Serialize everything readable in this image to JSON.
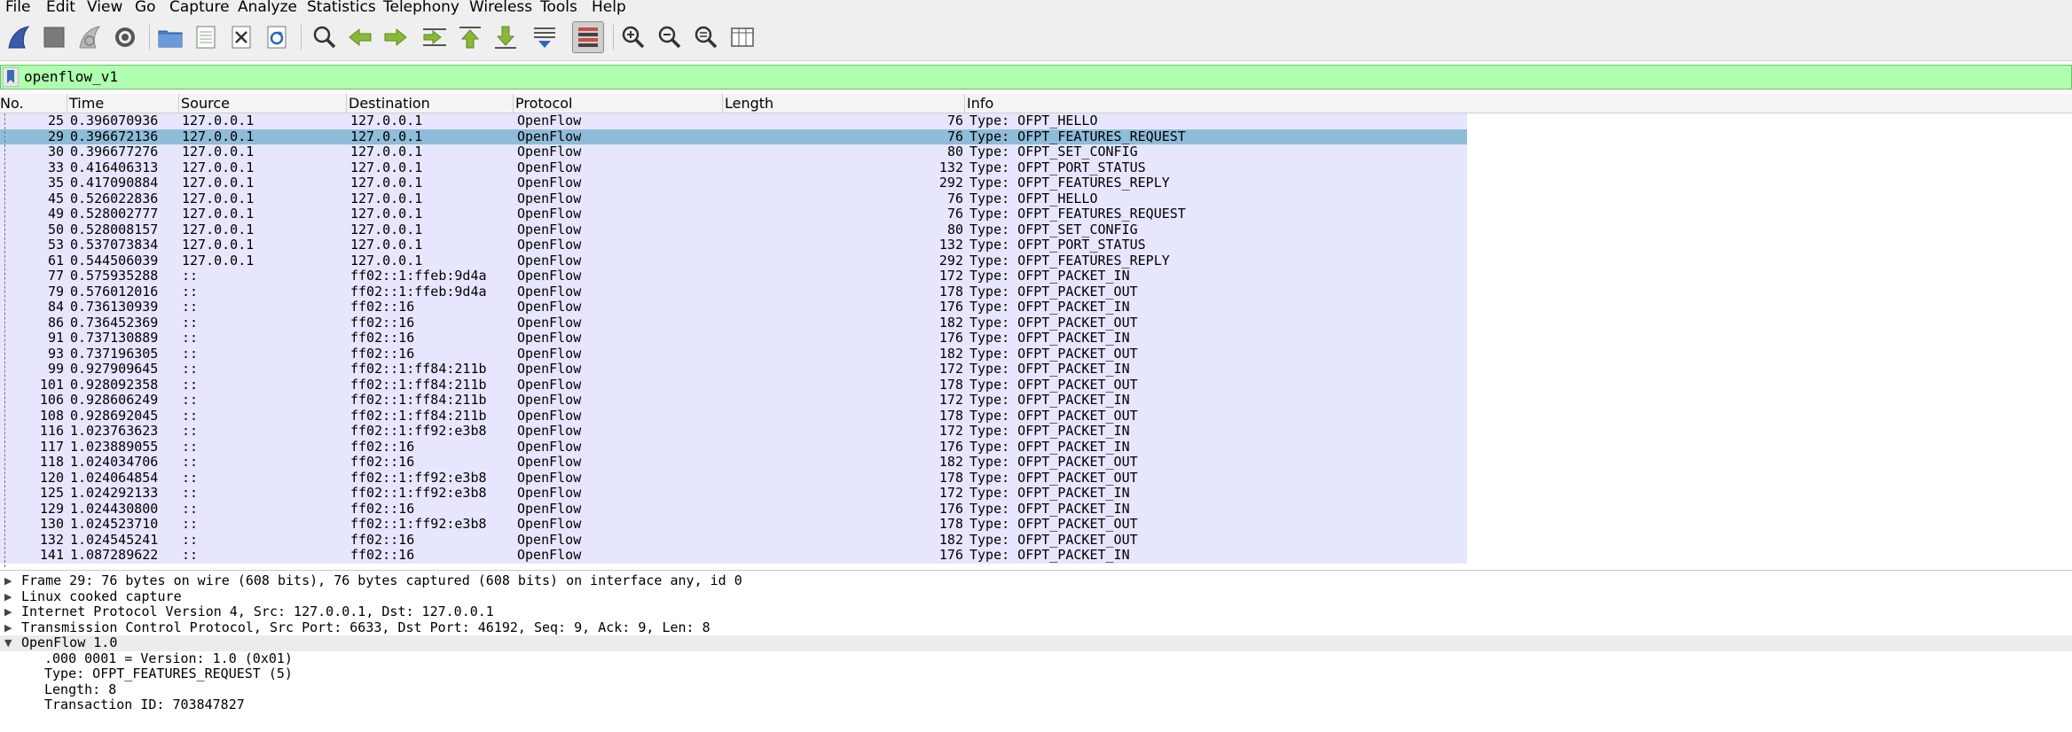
{
  "menu": [
    "File",
    "Edit",
    "View",
    "Go",
    "Capture",
    "Analyze",
    "Statistics",
    "Telephony",
    "Wireless",
    "Tools",
    "Help"
  ],
  "toolbar_icons": [
    "shark-fin-start-icon",
    "stop-square-icon",
    "shark-fin-restart-icon",
    "gear-options-icon",
    "folder-open-icon",
    "file-save-icon",
    "file-close-icon",
    "reload-icon",
    "find-magnifier-icon",
    "go-back-arrow-icon",
    "go-forward-arrow-icon",
    "go-to-packet-icon",
    "go-first-packet-icon",
    "go-last-packet-icon",
    "autoscroll-icon",
    "colorize-icon",
    "zoom-in-icon",
    "zoom-out-icon",
    "zoom-normal-icon",
    "resize-columns-icon"
  ],
  "filter": {
    "value": "openflow_v1"
  },
  "columns": [
    "No.",
    "Time",
    "Source",
    "Destination",
    "Protocol",
    "Length",
    "Info"
  ],
  "packets": [
    {
      "no": "25",
      "time": "0.396070936",
      "src": "127.0.0.1",
      "dst": "127.0.0.1",
      "proto": "OpenFlow",
      "len": "76",
      "info": "Type: OFPT_HELLO"
    },
    {
      "no": "29",
      "time": "0.396672136",
      "src": "127.0.0.1",
      "dst": "127.0.0.1",
      "proto": "OpenFlow",
      "len": "76",
      "info": "Type: OFPT_FEATURES_REQUEST",
      "selected": true
    },
    {
      "no": "30",
      "time": "0.396677276",
      "src": "127.0.0.1",
      "dst": "127.0.0.1",
      "proto": "OpenFlow",
      "len": "80",
      "info": "Type: OFPT_SET_CONFIG"
    },
    {
      "no": "33",
      "time": "0.416406313",
      "src": "127.0.0.1",
      "dst": "127.0.0.1",
      "proto": "OpenFlow",
      "len": "132",
      "info": "Type: OFPT_PORT_STATUS"
    },
    {
      "no": "35",
      "time": "0.417090884",
      "src": "127.0.0.1",
      "dst": "127.0.0.1",
      "proto": "OpenFlow",
      "len": "292",
      "info": "Type: OFPT_FEATURES_REPLY"
    },
    {
      "no": "45",
      "time": "0.526022836",
      "src": "127.0.0.1",
      "dst": "127.0.0.1",
      "proto": "OpenFlow",
      "len": "76",
      "info": "Type: OFPT_HELLO"
    },
    {
      "no": "49",
      "time": "0.528002777",
      "src": "127.0.0.1",
      "dst": "127.0.0.1",
      "proto": "OpenFlow",
      "len": "76",
      "info": "Type: OFPT_FEATURES_REQUEST"
    },
    {
      "no": "50",
      "time": "0.528008157",
      "src": "127.0.0.1",
      "dst": "127.0.0.1",
      "proto": "OpenFlow",
      "len": "80",
      "info": "Type: OFPT_SET_CONFIG"
    },
    {
      "no": "53",
      "time": "0.537073834",
      "src": "127.0.0.1",
      "dst": "127.0.0.1",
      "proto": "OpenFlow",
      "len": "132",
      "info": "Type: OFPT_PORT_STATUS"
    },
    {
      "no": "61",
      "time": "0.544506039",
      "src": "127.0.0.1",
      "dst": "127.0.0.1",
      "proto": "OpenFlow",
      "len": "292",
      "info": "Type: OFPT_FEATURES_REPLY"
    },
    {
      "no": "77",
      "time": "0.575935288",
      "src": "::",
      "dst": "ff02::1:ffeb:9d4a",
      "proto": "OpenFlow",
      "len": "172",
      "info": "Type: OFPT_PACKET_IN"
    },
    {
      "no": "79",
      "time": "0.576012016",
      "src": "::",
      "dst": "ff02::1:ffeb:9d4a",
      "proto": "OpenFlow",
      "len": "178",
      "info": "Type: OFPT_PACKET_OUT"
    },
    {
      "no": "84",
      "time": "0.736130939",
      "src": "::",
      "dst": "ff02::16",
      "proto": "OpenFlow",
      "len": "176",
      "info": "Type: OFPT_PACKET_IN"
    },
    {
      "no": "86",
      "time": "0.736452369",
      "src": "::",
      "dst": "ff02::16",
      "proto": "OpenFlow",
      "len": "182",
      "info": "Type: OFPT_PACKET_OUT"
    },
    {
      "no": "91",
      "time": "0.737130889",
      "src": "::",
      "dst": "ff02::16",
      "proto": "OpenFlow",
      "len": "176",
      "info": "Type: OFPT_PACKET_IN"
    },
    {
      "no": "93",
      "time": "0.737196305",
      "src": "::",
      "dst": "ff02::16",
      "proto": "OpenFlow",
      "len": "182",
      "info": "Type: OFPT_PACKET_OUT"
    },
    {
      "no": "99",
      "time": "0.927909645",
      "src": "::",
      "dst": "ff02::1:ff84:211b",
      "proto": "OpenFlow",
      "len": "172",
      "info": "Type: OFPT_PACKET_IN"
    },
    {
      "no": "101",
      "time": "0.928092358",
      "src": "::",
      "dst": "ff02::1:ff84:211b",
      "proto": "OpenFlow",
      "len": "178",
      "info": "Type: OFPT_PACKET_OUT"
    },
    {
      "no": "106",
      "time": "0.928606249",
      "src": "::",
      "dst": "ff02::1:ff84:211b",
      "proto": "OpenFlow",
      "len": "172",
      "info": "Type: OFPT_PACKET_IN"
    },
    {
      "no": "108",
      "time": "0.928692045",
      "src": "::",
      "dst": "ff02::1:ff84:211b",
      "proto": "OpenFlow",
      "len": "178",
      "info": "Type: OFPT_PACKET_OUT"
    },
    {
      "no": "116",
      "time": "1.023763623",
      "src": "::",
      "dst": "ff02::1:ff92:e3b8",
      "proto": "OpenFlow",
      "len": "172",
      "info": "Type: OFPT_PACKET_IN"
    },
    {
      "no": "117",
      "time": "1.023889055",
      "src": "::",
      "dst": "ff02::16",
      "proto": "OpenFlow",
      "len": "176",
      "info": "Type: OFPT_PACKET_IN"
    },
    {
      "no": "118",
      "time": "1.024034706",
      "src": "::",
      "dst": "ff02::16",
      "proto": "OpenFlow",
      "len": "182",
      "info": "Type: OFPT_PACKET_OUT"
    },
    {
      "no": "120",
      "time": "1.024064854",
      "src": "::",
      "dst": "ff02::1:ff92:e3b8",
      "proto": "OpenFlow",
      "len": "178",
      "info": "Type: OFPT_PACKET_OUT"
    },
    {
      "no": "125",
      "time": "1.024292133",
      "src": "::",
      "dst": "ff02::1:ff92:e3b8",
      "proto": "OpenFlow",
      "len": "172",
      "info": "Type: OFPT_PACKET_IN"
    },
    {
      "no": "129",
      "time": "1.024430800",
      "src": "::",
      "dst": "ff02::16",
      "proto": "OpenFlow",
      "len": "176",
      "info": "Type: OFPT_PACKET_IN"
    },
    {
      "no": "130",
      "time": "1.024523710",
      "src": "::",
      "dst": "ff02::1:ff92:e3b8",
      "proto": "OpenFlow",
      "len": "178",
      "info": "Type: OFPT_PACKET_OUT"
    },
    {
      "no": "132",
      "time": "1.024545241",
      "src": "::",
      "dst": "ff02::16",
      "proto": "OpenFlow",
      "len": "182",
      "info": "Type: OFPT_PACKET_OUT"
    },
    {
      "no": "141",
      "time": "1.087289622",
      "src": "::",
      "dst": "ff02::16",
      "proto": "OpenFlow",
      "len": "176",
      "info": "Type: OFPT_PACKET_IN"
    }
  ],
  "details": [
    {
      "text": "Frame 29: 76 bytes on wire (608 bits), 76 bytes captured (608 bits) on interface any, id 0",
      "arrow": "▶",
      "child": false,
      "hl": false
    },
    {
      "text": "Linux cooked capture",
      "arrow": "▶",
      "child": false,
      "hl": false
    },
    {
      "text": "Internet Protocol Version 4, Src: 127.0.0.1, Dst: 127.0.0.1",
      "arrow": "▶",
      "child": false,
      "hl": false
    },
    {
      "text": "Transmission Control Protocol, Src Port: 6633, Dst Port: 46192, Seq: 9, Ack: 9, Len: 8",
      "arrow": "▶",
      "child": false,
      "hl": false
    },
    {
      "text": "OpenFlow 1.0",
      "arrow": "▼",
      "child": false,
      "hl": true
    },
    {
      "text": ".000 0001 = Version: 1.0 (0x01)",
      "arrow": "",
      "child": true,
      "hl": false
    },
    {
      "text": "Type: OFPT_FEATURES_REQUEST (5)",
      "arrow": "",
      "child": true,
      "hl": false
    },
    {
      "text": "Length: 8",
      "arrow": "",
      "child": true,
      "hl": false
    },
    {
      "text": "Transaction ID: 703847827",
      "arrow": "",
      "child": true,
      "hl": false
    }
  ],
  "colors": {
    "row_bg": "#e7e6ff",
    "selected_bg": "#8fbcd9",
    "filter_bg": "#afffaf"
  }
}
